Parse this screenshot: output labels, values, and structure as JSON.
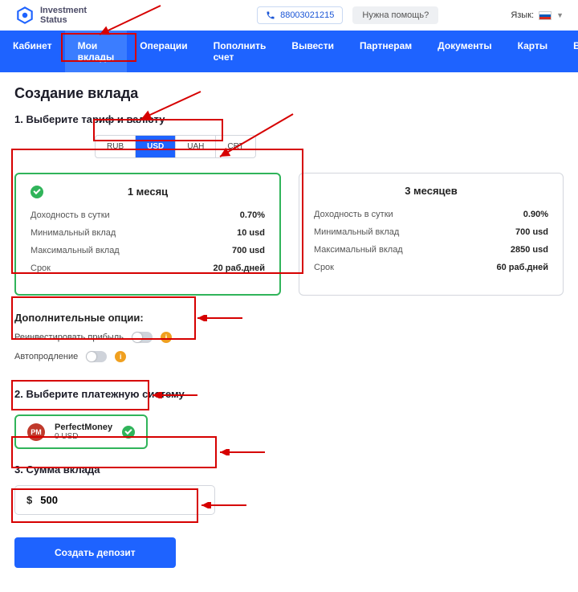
{
  "brand": {
    "line1": "Investment",
    "line2": "Status"
  },
  "header": {
    "phone": "88003021215",
    "help": "Нужна помощь?",
    "lang_label": "Язык:"
  },
  "nav": {
    "cabinet": "Кабинет",
    "deposits": "Мои вклады",
    "operations": "Операции",
    "topup": "Пополнить счет",
    "withdraw": "Вывести",
    "partners": "Партнерам",
    "documents": "Документы",
    "cards": "Карты",
    "logout": "Выход"
  },
  "page_title": "Создание вклада",
  "step1_title": "1. Выберите тариф и валюту",
  "currencies": {
    "rub": "RUB",
    "usd": "USD",
    "uah": "UAH",
    "crt": "CRT"
  },
  "plan_labels": {
    "daily_yield": "Доходность в сутки",
    "min": "Минимальный вклад",
    "max": "Максимальный вклад",
    "term": "Срок"
  },
  "plan1": {
    "title": "1 месяц",
    "yield": "0.70%",
    "min": "10 usd",
    "max": "700 usd",
    "term": "20 раб.дней"
  },
  "plan2": {
    "title": "3 месяцев",
    "yield": "0.90%",
    "min": "700 usd",
    "max": "2850 usd",
    "term": "60 раб.дней"
  },
  "options_title": "Дополнительные опции:",
  "options": {
    "reinvest": "Реинвестировать прибыль",
    "autorenew": "Автопродление"
  },
  "step2_title": "2. Выберите платежную систему",
  "pay": {
    "name": "PerfectMoney",
    "balance": "0 USD",
    "icon_text": "PM"
  },
  "step3_title": "3. Сумма вклада",
  "amount": {
    "currency": "$",
    "value": "500"
  },
  "cta": "Создать депозит"
}
